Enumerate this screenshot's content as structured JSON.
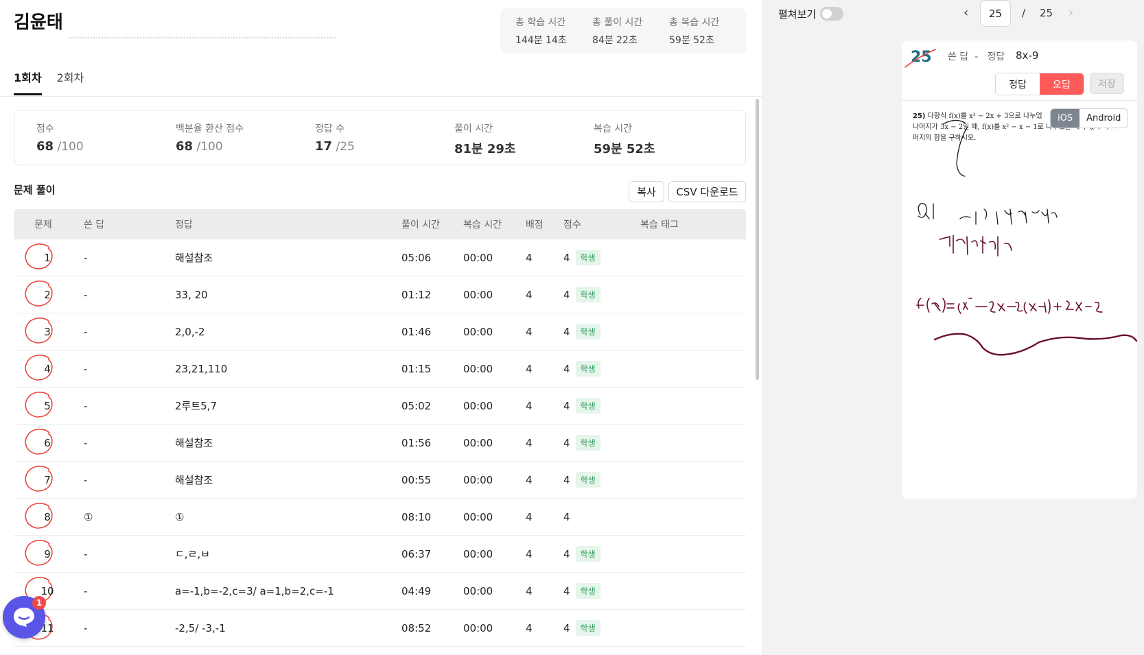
{
  "student": {
    "name": "김윤태"
  },
  "totals": [
    {
      "label": "총 학습 시간",
      "value": "144분 14초"
    },
    {
      "label": "총 풀이 시간",
      "value": "84분 22초"
    },
    {
      "label": "총 복습 시간",
      "value": "59분 52초"
    }
  ],
  "tabs": [
    {
      "label": "1회차",
      "active": true
    },
    {
      "label": "2회차",
      "active": false
    }
  ],
  "summary": {
    "score": {
      "label": "점수",
      "value": "68",
      "max": " /100"
    },
    "percent": {
      "label": "백분율 환산 점수",
      "value": "68",
      "max": " /100"
    },
    "correct": {
      "label": "정답 수",
      "value": "17",
      "max": " /25"
    },
    "solve_time": {
      "label": "풀이 시간",
      "value": "81분 29초"
    },
    "review_time": {
      "label": "복습 시간",
      "value": "59분 52초"
    }
  },
  "section": {
    "title": "문제 풀이",
    "copy_label": "복사",
    "csv_label": "CSV 다운로드"
  },
  "table": {
    "headers": [
      "문제",
      "쓴 답",
      "정답",
      "풀이 시간",
      "복습 시간",
      "배점",
      "점수",
      "복습 태그"
    ],
    "rows": [
      {
        "q": "1",
        "written": "-",
        "answer": "해설참조",
        "solve": "05:06",
        "review": "00:00",
        "points": "4",
        "score": "4",
        "tag": "학생"
      },
      {
        "q": "2",
        "written": "-",
        "answer": "33, 20",
        "solve": "01:12",
        "review": "00:00",
        "points": "4",
        "score": "4",
        "tag": "학생"
      },
      {
        "q": "3",
        "written": "-",
        "answer": "2,0,-2",
        "solve": "01:46",
        "review": "00:00",
        "points": "4",
        "score": "4",
        "tag": "학생"
      },
      {
        "q": "4",
        "written": "-",
        "answer": "23,21,110",
        "solve": "01:15",
        "review": "00:00",
        "points": "4",
        "score": "4",
        "tag": "학생"
      },
      {
        "q": "5",
        "written": "-",
        "answer": "2루트5,7",
        "solve": "05:02",
        "review": "00:00",
        "points": "4",
        "score": "4",
        "tag": "학생"
      },
      {
        "q": "6",
        "written": "-",
        "answer": "해설참조",
        "solve": "01:56",
        "review": "00:00",
        "points": "4",
        "score": "4",
        "tag": "학생"
      },
      {
        "q": "7",
        "written": "-",
        "answer": "해설참조",
        "solve": "00:55",
        "review": "00:00",
        "points": "4",
        "score": "4",
        "tag": "학생"
      },
      {
        "q": "8",
        "written": "①",
        "answer": "①",
        "solve": "08:10",
        "review": "00:00",
        "points": "4",
        "score": "4",
        "tag": ""
      },
      {
        "q": "9",
        "written": "-",
        "answer": "ㄷ,ㄹ,ㅂ",
        "solve": "06:37",
        "review": "00:00",
        "points": "4",
        "score": "4",
        "tag": "학생"
      },
      {
        "q": "10",
        "written": "-",
        "answer": "a=-1,b=-2,c=3/ a=1,b=2,c=-1",
        "solve": "04:49",
        "review": "00:00",
        "points": "4",
        "score": "4",
        "tag": "학생"
      },
      {
        "q": "11",
        "written": "-",
        "answer": "-2,5/ -3,-1",
        "solve": "08:52",
        "review": "00:00",
        "points": "4",
        "score": "4",
        "tag": "학생"
      }
    ]
  },
  "chat": {
    "badge": "1"
  },
  "viewer": {
    "spread_label": "펼쳐보기",
    "page_current": "25",
    "page_sep": "/",
    "page_total": "25",
    "card": {
      "num": "25",
      "written_label": "쓴 답",
      "written_value": "-",
      "correct_label": "정답",
      "correct_value": "8x-9",
      "btn_correct": "정답",
      "btn_wrong": "오답",
      "btn_save": "저장",
      "problem_num": "25)",
      "problem_line1": "다항식 f(x)를 x² − 2x + 3으로 나누었",
      "problem_line2": "나머지가 3x − 2일 때, f(x)를 x² − x − 1로 나누었을 때의 몫과 나",
      "problem_line3": "머지의 합을 구하시오.",
      "os_ios": "iOS",
      "os_android": "Android"
    },
    "ink_color": "#6a0f2a"
  }
}
